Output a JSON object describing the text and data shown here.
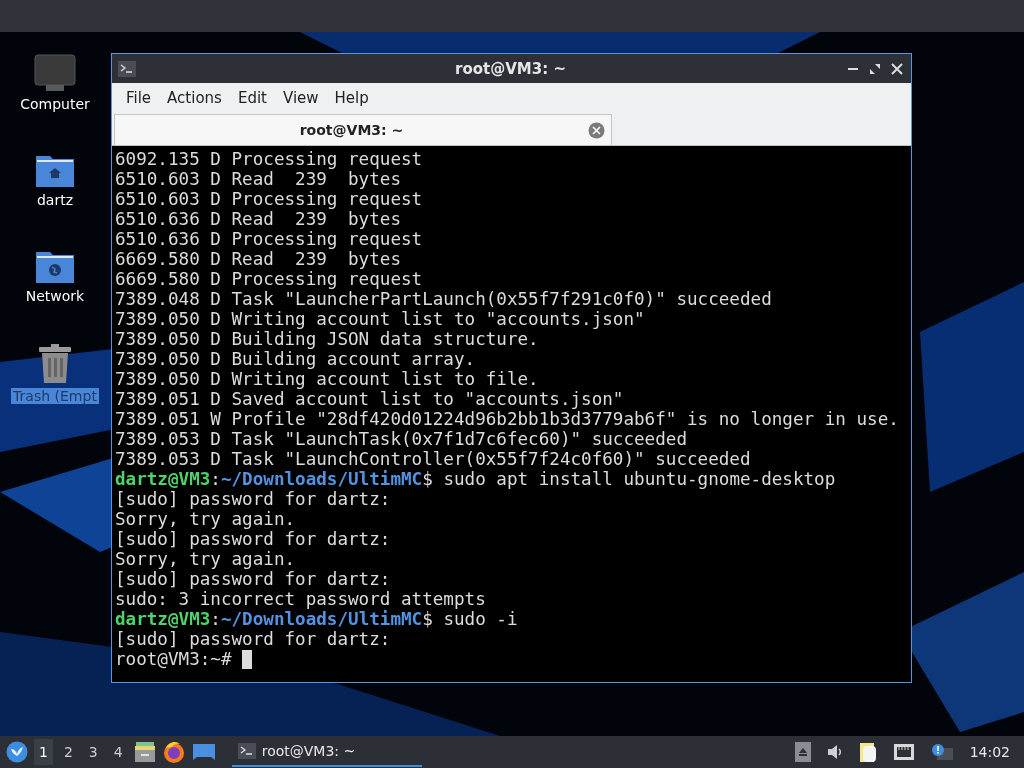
{
  "desktop_icons": [
    {
      "kind": "computer",
      "label": "Computer",
      "selected": false
    },
    {
      "kind": "home",
      "label": "dartz",
      "selected": false
    },
    {
      "kind": "network",
      "label": "Network",
      "selected": false
    },
    {
      "kind": "trash",
      "label": "Trash (Empt",
      "selected": true
    }
  ],
  "window": {
    "title": "root@VM3: ~",
    "menu": [
      "File",
      "Actions",
      "Edit",
      "View",
      "Help"
    ],
    "tabs": [
      {
        "label": "root@VM3: ~",
        "selected": true
      }
    ],
    "terminal": {
      "cursor": true,
      "lines": [
        [
          {
            "kind": "plain",
            "text": "6092.135 D Processing request"
          }
        ],
        [
          {
            "kind": "plain",
            "text": "6510.603 D Read  239  bytes"
          }
        ],
        [
          {
            "kind": "plain",
            "text": "6510.603 D Processing request"
          }
        ],
        [
          {
            "kind": "plain",
            "text": "6510.636 D Read  239  bytes"
          }
        ],
        [
          {
            "kind": "plain",
            "text": "6510.636 D Processing request"
          }
        ],
        [
          {
            "kind": "plain",
            "text": "6669.580 D Read  239  bytes"
          }
        ],
        [
          {
            "kind": "plain",
            "text": "6669.580 D Processing request"
          }
        ],
        [
          {
            "kind": "plain",
            "text": "7389.048 D Task \"LauncherPartLaunch(0x55f7f291c0f0)\" succeeded"
          }
        ],
        [
          {
            "kind": "plain",
            "text": "7389.050 D Writing account list to \"accounts.json\""
          }
        ],
        [
          {
            "kind": "plain",
            "text": "7389.050 D Building JSON data structure."
          }
        ],
        [
          {
            "kind": "plain",
            "text": "7389.050 D Building account array."
          }
        ],
        [
          {
            "kind": "plain",
            "text": "7389.050 D Writing account list to file."
          }
        ],
        [
          {
            "kind": "plain",
            "text": "7389.051 D Saved account list to \"accounts.json\""
          }
        ],
        [
          {
            "kind": "plain",
            "text": "7389.051 W Profile \"28df420d01224d96b2bb1b3d3779ab6f\" is no longer in use."
          }
        ],
        [
          {
            "kind": "plain",
            "text": "7389.053 D Task \"LaunchTask(0x7f1d7c6fec60)\" succeeded"
          }
        ],
        [
          {
            "kind": "plain",
            "text": "7389.053 D Task \"LaunchController(0x55f7f24c0f60)\" succeeded"
          }
        ],
        [
          {
            "kind": "user",
            "text": "dartz@VM3"
          },
          {
            "kind": "plain",
            "text": ":"
          },
          {
            "kind": "path",
            "text": "~/Downloads/UltimMC"
          },
          {
            "kind": "plain",
            "text": "$ sudo apt install ubuntu-gnome-desktop"
          }
        ],
        [
          {
            "kind": "plain",
            "text": "[sudo] password for dartz:"
          }
        ],
        [
          {
            "kind": "plain",
            "text": "Sorry, try again."
          }
        ],
        [
          {
            "kind": "plain",
            "text": "[sudo] password for dartz:"
          }
        ],
        [
          {
            "kind": "plain",
            "text": "Sorry, try again."
          }
        ],
        [
          {
            "kind": "plain",
            "text": "[sudo] password for dartz:"
          }
        ],
        [
          {
            "kind": "plain",
            "text": "sudo: 3 incorrect password attempts"
          }
        ],
        [
          {
            "kind": "user",
            "text": "dartz@VM3"
          },
          {
            "kind": "plain",
            "text": ":"
          },
          {
            "kind": "path",
            "text": "~/Downloads/UltimMC"
          },
          {
            "kind": "plain",
            "text": "$ sudo -i"
          }
        ],
        [
          {
            "kind": "plain",
            "text": "[sudo] password for dartz:"
          }
        ],
        [
          {
            "kind": "plain",
            "text": "root@VM3:~# "
          }
        ]
      ]
    }
  },
  "taskbar": {
    "workspaces": [
      {
        "label": "1",
        "selected": true
      },
      {
        "label": "2",
        "selected": false
      },
      {
        "label": "3",
        "selected": false
      },
      {
        "label": "4",
        "selected": false
      }
    ],
    "launchers": [
      {
        "kind": "files"
      },
      {
        "kind": "browser"
      },
      {
        "kind": "desktop"
      }
    ],
    "tasks": [
      {
        "label": "root@VM3: ~",
        "selected": true
      }
    ],
    "tray": [
      {
        "kind": "eject"
      },
      {
        "kind": "volume"
      },
      {
        "kind": "clipboard"
      },
      {
        "kind": "network"
      },
      {
        "kind": "notification"
      }
    ],
    "clock": "14:02"
  }
}
